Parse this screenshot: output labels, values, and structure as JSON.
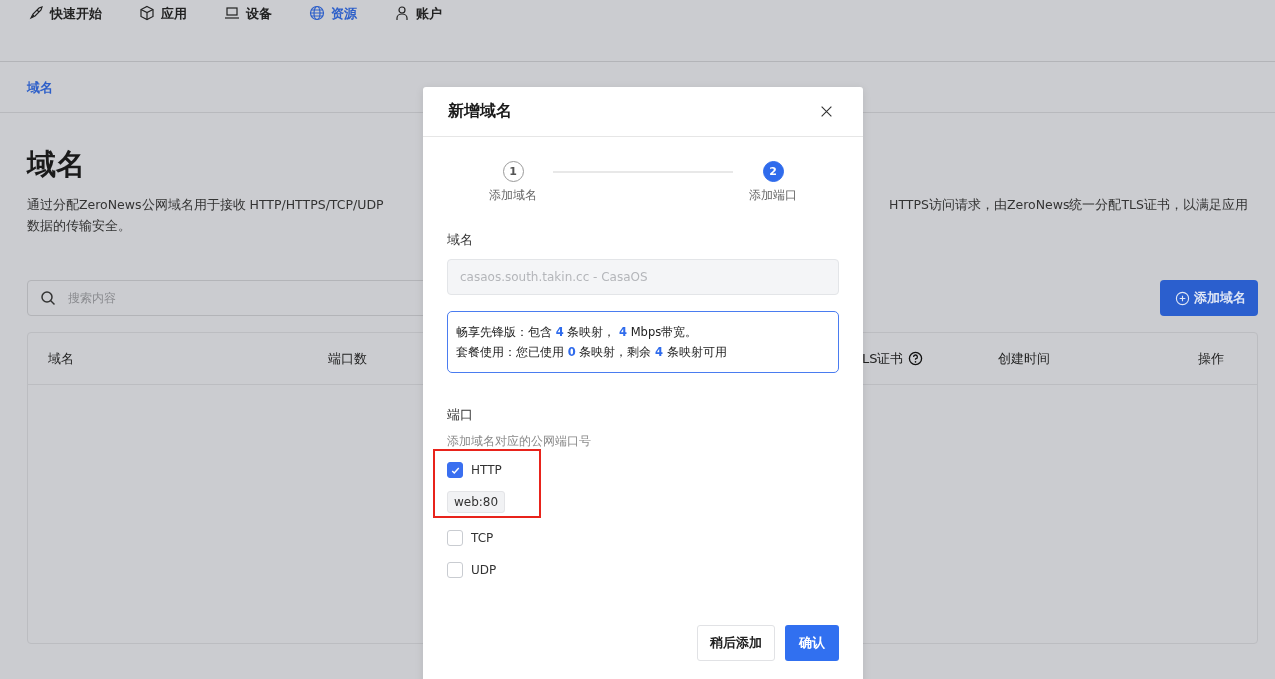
{
  "nav": [
    {
      "label": "快速开始",
      "selected": false
    },
    {
      "label": "应用",
      "selected": false
    },
    {
      "label": "设备",
      "selected": false
    },
    {
      "label": "资源",
      "selected": true
    },
    {
      "label": "账户",
      "selected": false
    }
  ],
  "tabs": [
    {
      "label": "域名",
      "selected": true
    }
  ],
  "page": {
    "title": "域名",
    "description_left": "通过分配ZeroNews公网域名用于接收 HTTP/HTTPS/TCP/UDP",
    "description_right": "HTTPS访问请求，由ZeroNews统一分配TLS证书，以满足应用",
    "description_line2": "数据的传输安全。"
  },
  "search": {
    "placeholder": "搜索内容"
  },
  "add_button": "添加域名",
  "table": {
    "columns": [
      {
        "label": "域名",
        "help": false
      },
      {
        "label": "端口数",
        "help": false
      },
      {
        "label": "LS证书",
        "help": true
      },
      {
        "label": "创建时间",
        "help": false
      },
      {
        "label": "操作",
        "help": false
      }
    ]
  },
  "dialog": {
    "title": "新增域名",
    "steps": [
      {
        "number": "1",
        "label": "添加域名",
        "selected": false
      },
      {
        "number": "2",
        "label": "添加端口",
        "selected": true
      }
    ],
    "domain_label": "域名",
    "domain_value": "casaos.south.takin.cc - CasaOS",
    "info_lines": [
      [
        {
          "text": "畅享先锋版：包含 ",
          "kind": "text"
        },
        {
          "text": "4",
          "kind": "number"
        },
        {
          "text": " 条映射， ",
          "kind": "text"
        },
        {
          "text": "4",
          "kind": "number"
        },
        {
          "text": " Mbps带宽。",
          "kind": "text"
        }
      ],
      [
        {
          "text": "套餐使用：您已使用 ",
          "kind": "text"
        },
        {
          "text": "0",
          "kind": "number"
        },
        {
          "text": " 条映射，剩余 ",
          "kind": "text"
        },
        {
          "text": "4",
          "kind": "number"
        },
        {
          "text": " 条映射可用",
          "kind": "text"
        }
      ]
    ],
    "port_label": "端口",
    "port_hint": "添加域名对应的公网端口号",
    "ports": [
      {
        "label": "HTTP",
        "checked": true,
        "tags": [
          "web:80"
        ],
        "highlighted": true
      },
      {
        "label": "TCP",
        "checked": false,
        "highlighted": false
      },
      {
        "label": "UDP",
        "checked": false,
        "highlighted": false
      }
    ],
    "buttons": [
      {
        "label": "稍后添加",
        "kind": "secondary"
      },
      {
        "label": "确认",
        "kind": "primary"
      }
    ]
  }
}
